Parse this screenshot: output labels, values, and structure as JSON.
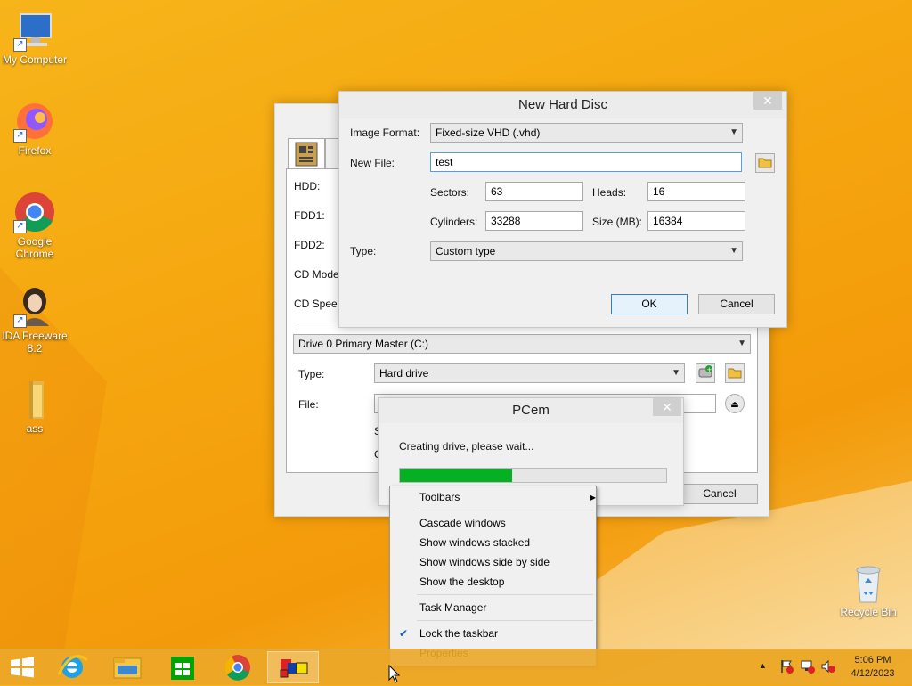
{
  "desktop": {
    "icons": [
      {
        "label": "My Computer"
      },
      {
        "label": "Firefox"
      },
      {
        "label": "Google Chrome"
      },
      {
        "label": "IDA Freeware 8.2"
      },
      {
        "label": "ass"
      },
      {
        "label": "Recycle Bin"
      }
    ]
  },
  "settings_window": {
    "labels": {
      "hdd": "HDD:",
      "fdd1": "FDD1:",
      "fdd2": "FDD2:",
      "cd_model": "CD Mode",
      "cd_speed": "CD Speed",
      "type": "Type:",
      "file": "File:"
    },
    "drive_select": "Drive 0 Primary Master (C:)",
    "type_select": "Hard drive",
    "file_value": "",
    "fragment_s": "S",
    "fragment_c": "C",
    "cancel_label": "Cancel"
  },
  "new_hd_dialog": {
    "title": "New Hard Disc",
    "image_format_label": "Image Format:",
    "image_format_value": "Fixed-size VHD (.vhd)",
    "new_file_label": "New File:",
    "new_file_value": "test",
    "sectors_label": "Sectors:",
    "sectors_value": "63",
    "heads_label": "Heads:",
    "heads_value": "16",
    "cylinders_label": "Cylinders:",
    "cylinders_value": "33288",
    "size_label": "Size (MB):",
    "size_value": "16384",
    "type_label": "Type:",
    "type_value": "Custom type",
    "ok_label": "OK",
    "cancel_label": "Cancel",
    "close_glyph": "✕"
  },
  "progress_dialog": {
    "title": "PCem",
    "message": "Creating drive, please wait...",
    "progress": 0.42,
    "close_glyph": "✕"
  },
  "context_menu": {
    "items": [
      {
        "label": "Toolbars",
        "submenu": true
      },
      {
        "label": "Cascade windows"
      },
      {
        "label": "Show windows stacked"
      },
      {
        "label": "Show windows side by side"
      },
      {
        "label": "Show the desktop"
      },
      {
        "label": "Task Manager"
      },
      {
        "label": "Lock the taskbar",
        "checked": true
      },
      {
        "label": "Properties"
      }
    ],
    "submenu_glyph": "▸",
    "check_glyph": "✔"
  },
  "taskbar": {
    "time": "5:06 PM",
    "date": "4/12/2023",
    "tray_up_glyph": "▲"
  },
  "colors": {
    "progress_fill": "#06b025",
    "desktop_orange": "#f5a40e"
  }
}
